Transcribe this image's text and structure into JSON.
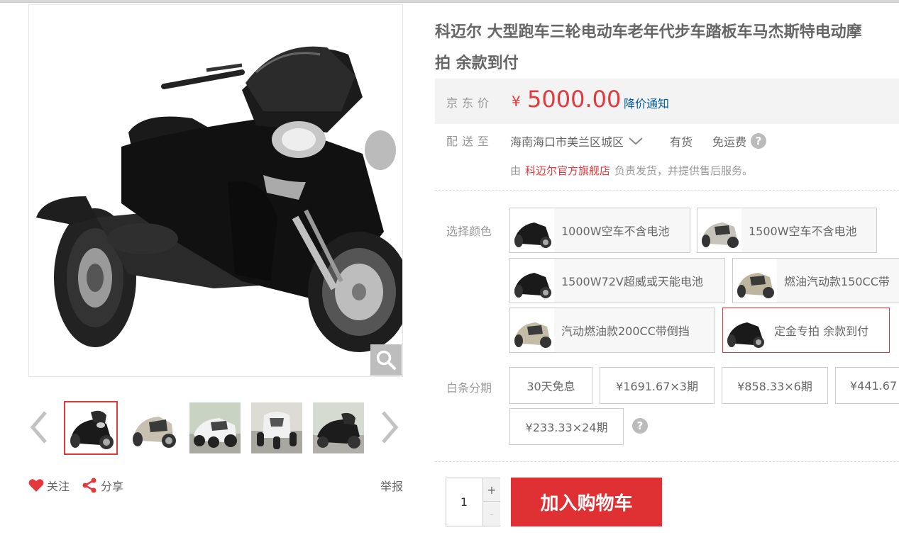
{
  "product": {
    "title_line1": "科迈尔 大型跑车三轮电动车老年代步车踏板车马杰斯特电动摩",
    "title_line2": "拍 余款到付"
  },
  "price": {
    "label": "京东价",
    "currency": "¥",
    "value": "5000.00",
    "notice_link": "降价通知"
  },
  "shipping": {
    "label": "配送至",
    "address": "海南海口市美兰区城区",
    "stock": "有货",
    "freight": "免运费",
    "seller_prefix": "由",
    "shop_name": "科迈尔官方旗舰店",
    "seller_suffix": "负责发货，并提供售后服务。"
  },
  "color": {
    "label": "选择颜色",
    "options": [
      {
        "text": "1000W空车不含电池",
        "tone": "dark"
      },
      {
        "text": "1500W空车不含电池",
        "tone": "silver"
      },
      {
        "text": "1500W72V超威或天能电池",
        "tone": "dark"
      },
      {
        "text": "燃油汽动款150CC带",
        "tone": "gold"
      },
      {
        "text": "汽动燃油款200CC带倒挡",
        "tone": "gold"
      },
      {
        "text": "定金专拍 余款到付",
        "tone": "dark",
        "selected": true
      }
    ]
  },
  "installment": {
    "label": "白条分期",
    "options": [
      "30天免息",
      "¥1691.67×3期",
      "¥858.33×6期",
      "¥441.67",
      "¥233.33×24期"
    ]
  },
  "quantity": {
    "value": "1",
    "plus": "+",
    "minus": "-"
  },
  "cart_button": "加入购物车",
  "actions": {
    "follow": "关注",
    "share": "分享",
    "report": "举报"
  },
  "colors": {
    "accent": "#e4393c",
    "link": "#005aa0",
    "price_bg": "#f3f3f3"
  }
}
